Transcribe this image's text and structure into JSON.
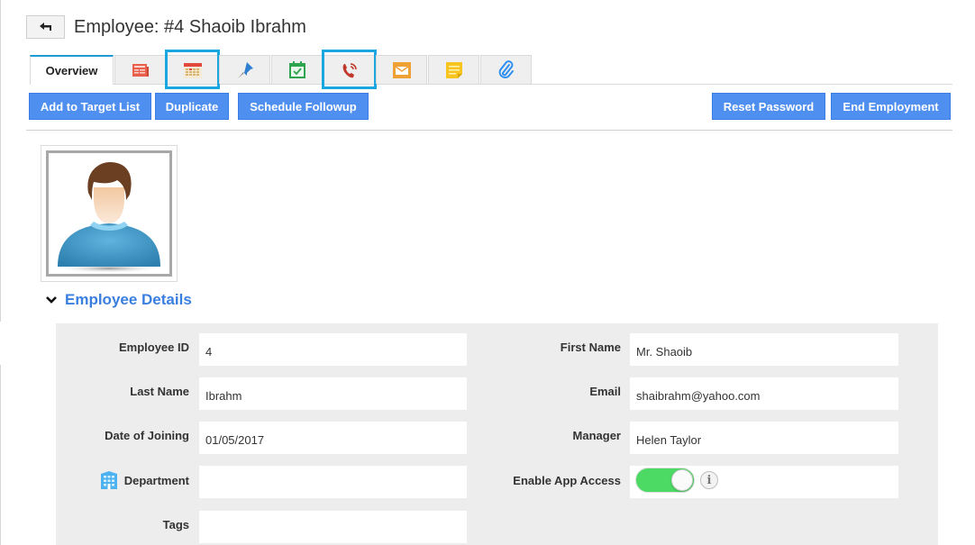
{
  "header": {
    "back_icon": "back-arrow-icon",
    "title": "Employee: #4 Shaoib Ibrahm"
  },
  "tabs": [
    {
      "label": "Overview",
      "active": true
    },
    {
      "icon": "newspaper-icon",
      "highlighted": false
    },
    {
      "icon": "calendar-icon",
      "highlighted": true
    },
    {
      "icon": "pin-icon",
      "highlighted": false
    },
    {
      "icon": "calendar-check-icon",
      "highlighted": false
    },
    {
      "icon": "phone-call-icon",
      "highlighted": true
    },
    {
      "icon": "email-icon",
      "highlighted": false
    },
    {
      "icon": "sticky-note-icon",
      "highlighted": false
    },
    {
      "icon": "paperclip-icon",
      "highlighted": false
    }
  ],
  "toolbar": {
    "add_to_target_list": "Add to Target List",
    "duplicate": "Duplicate",
    "schedule_followup": "Schedule Followup",
    "reset_password": "Reset Password",
    "end_employment": "End Employment"
  },
  "section": {
    "title": "Employee Details",
    "expanded": true
  },
  "fields": {
    "employee_id": {
      "label": "Employee ID",
      "value": "4"
    },
    "first_name": {
      "label": "First Name",
      "value": "Mr. Shaoib"
    },
    "last_name": {
      "label": "Last Name",
      "value": "Ibrahm"
    },
    "email": {
      "label": "Email",
      "value": "shaibrahm@yahoo.com"
    },
    "date_of_joining": {
      "label": "Date of Joining",
      "value": "01/05/2017"
    },
    "manager": {
      "label": "Manager",
      "value": "Helen Taylor"
    },
    "department": {
      "label": "Department",
      "value": ""
    },
    "enable_app_access": {
      "label": "Enable App Access",
      "value": true
    },
    "tags": {
      "label": "Tags",
      "value": ""
    }
  },
  "colors": {
    "button_blue": "#4f8ff0",
    "highlight_cyan": "#1aa7e0",
    "section_blue": "#3a7fe0",
    "toggle_green": "#4cd964"
  }
}
